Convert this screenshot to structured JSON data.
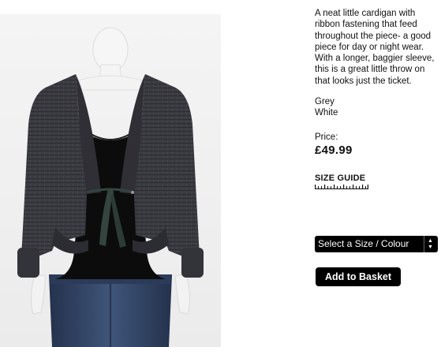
{
  "product": {
    "image_alt": "Grey knit cardigan with ribbon tie on mannequin",
    "description": "A neat little cardigan with ribbon fastening that feed throughout the piece- a good piece for day or night wear. With a longer, baggier sleeve, this is a great little throw on that looks just the ticket.",
    "colours": [
      "Grey",
      "White"
    ],
    "price_label": "Price:",
    "price": "£49.99"
  },
  "size_guide": {
    "label": "SIZE GUIDE"
  },
  "size_select": {
    "selected": "Select a Size / Colour",
    "arrow_up": "▲",
    "arrow_down": "▼"
  },
  "add_to_basket": {
    "label": "Add to Basket"
  },
  "colors": {
    "cardigan": "#3a3a40",
    "top": "#0b0b0b",
    "jeans": "#2e3e5c",
    "mannequin": "#f2f2f2",
    "ribbon": "#34453f",
    "button_bg": "#000000",
    "button_text": "#ffffff"
  }
}
